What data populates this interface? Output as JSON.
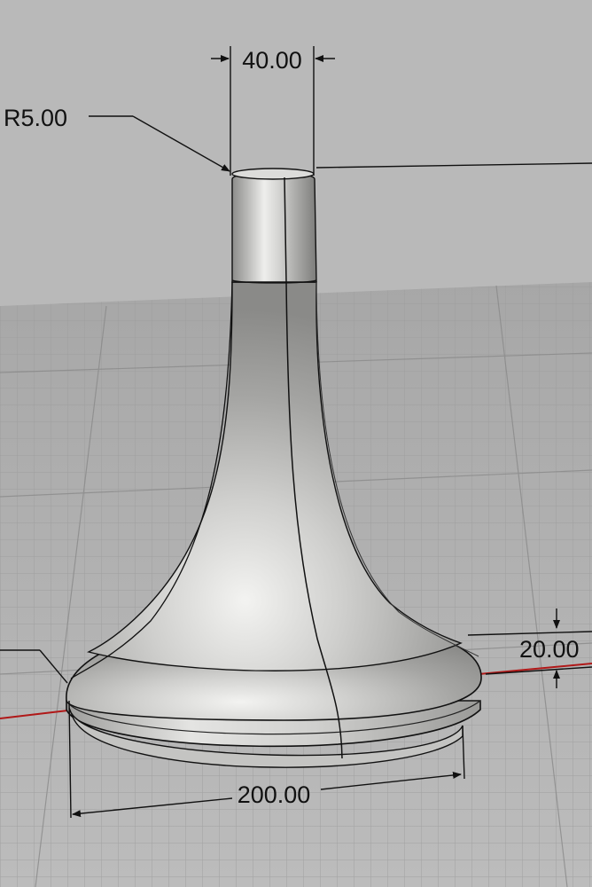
{
  "viewport": {
    "background_color": "#b8b8b8",
    "grid_color": "#9a9a9a",
    "grid_dark_color": "#7d7d7d",
    "x_axis_color": "#b01818",
    "model_color": "#c9c9c7",
    "edge_color": "#111111"
  },
  "dimensions": {
    "top_diameter": "40.00",
    "fillet_radius": "R5.00",
    "base_height": "20.00",
    "base_diameter": "200.00"
  }
}
